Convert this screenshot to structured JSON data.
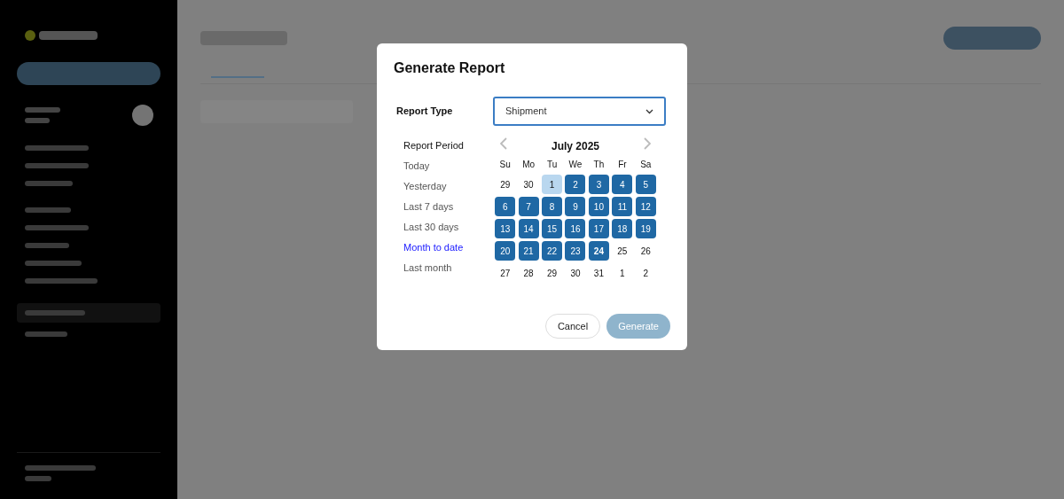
{
  "dialog": {
    "title": "Generate Report",
    "type_label": "Report Type",
    "type_value": "Shipment",
    "period_label": "Report Period",
    "periods": [
      {
        "label": "Today",
        "selected": false
      },
      {
        "label": "Yesterday",
        "selected": false
      },
      {
        "label": "Last 7 days",
        "selected": false
      },
      {
        "label": "Last 30 days",
        "selected": false
      },
      {
        "label": "Month to date",
        "selected": true
      },
      {
        "label": "Last month",
        "selected": false
      }
    ],
    "month": "July 2025",
    "weekdays": [
      "Su",
      "Mo",
      "Tu",
      "We",
      "Th",
      "Fr",
      "Sa"
    ],
    "days": [
      {
        "label": "29",
        "selected": false,
        "highlighted": false,
        "today": false
      },
      {
        "label": "30",
        "selected": false,
        "highlighted": false,
        "today": false
      },
      {
        "label": "1",
        "selected": false,
        "highlighted": true,
        "today": false
      },
      {
        "label": "2",
        "selected": true,
        "highlighted": false,
        "today": false
      },
      {
        "label": "3",
        "selected": true,
        "highlighted": false,
        "today": false
      },
      {
        "label": "4",
        "selected": true,
        "highlighted": false,
        "today": false
      },
      {
        "label": "5",
        "selected": true,
        "highlighted": false,
        "today": false
      },
      {
        "label": "6",
        "selected": true,
        "highlighted": false,
        "today": false
      },
      {
        "label": "7",
        "selected": true,
        "highlighted": false,
        "today": false
      },
      {
        "label": "8",
        "selected": true,
        "highlighted": false,
        "today": false
      },
      {
        "label": "9",
        "selected": true,
        "highlighted": false,
        "today": false
      },
      {
        "label": "10",
        "selected": true,
        "highlighted": false,
        "today": false
      },
      {
        "label": "11",
        "selected": true,
        "highlighted": false,
        "today": false
      },
      {
        "label": "12",
        "selected": true,
        "highlighted": false,
        "today": false
      },
      {
        "label": "13",
        "selected": true,
        "highlighted": false,
        "today": false
      },
      {
        "label": "14",
        "selected": true,
        "highlighted": false,
        "today": false
      },
      {
        "label": "15",
        "selected": true,
        "highlighted": false,
        "today": false
      },
      {
        "label": "16",
        "selected": true,
        "highlighted": false,
        "today": false
      },
      {
        "label": "17",
        "selected": true,
        "highlighted": false,
        "today": false
      },
      {
        "label": "18",
        "selected": true,
        "highlighted": false,
        "today": false
      },
      {
        "label": "19",
        "selected": true,
        "highlighted": false,
        "today": false
      },
      {
        "label": "20",
        "selected": true,
        "highlighted": false,
        "today": false
      },
      {
        "label": "21",
        "selected": true,
        "highlighted": false,
        "today": false
      },
      {
        "label": "22",
        "selected": true,
        "highlighted": false,
        "today": false
      },
      {
        "label": "23",
        "selected": true,
        "highlighted": false,
        "today": false
      },
      {
        "label": "24",
        "selected": true,
        "highlighted": false,
        "today": true
      },
      {
        "label": "25",
        "selected": false,
        "highlighted": false,
        "today": false
      },
      {
        "label": "26",
        "selected": false,
        "highlighted": false,
        "today": false
      },
      {
        "label": "27",
        "selected": false,
        "highlighted": false,
        "today": false
      },
      {
        "label": "28",
        "selected": false,
        "highlighted": false,
        "today": false
      },
      {
        "label": "29",
        "selected": false,
        "highlighted": false,
        "today": false
      },
      {
        "label": "30",
        "selected": false,
        "highlighted": false,
        "today": false
      },
      {
        "label": "31",
        "selected": false,
        "highlighted": false,
        "today": false
      },
      {
        "label": "1",
        "selected": false,
        "highlighted": false,
        "today": false
      },
      {
        "label": "2",
        "selected": false,
        "highlighted": false,
        "today": false
      }
    ],
    "buttons": [
      {
        "label": "Cancel",
        "kind": "secondary"
      },
      {
        "label": "Generate",
        "kind": "primary"
      }
    ]
  }
}
